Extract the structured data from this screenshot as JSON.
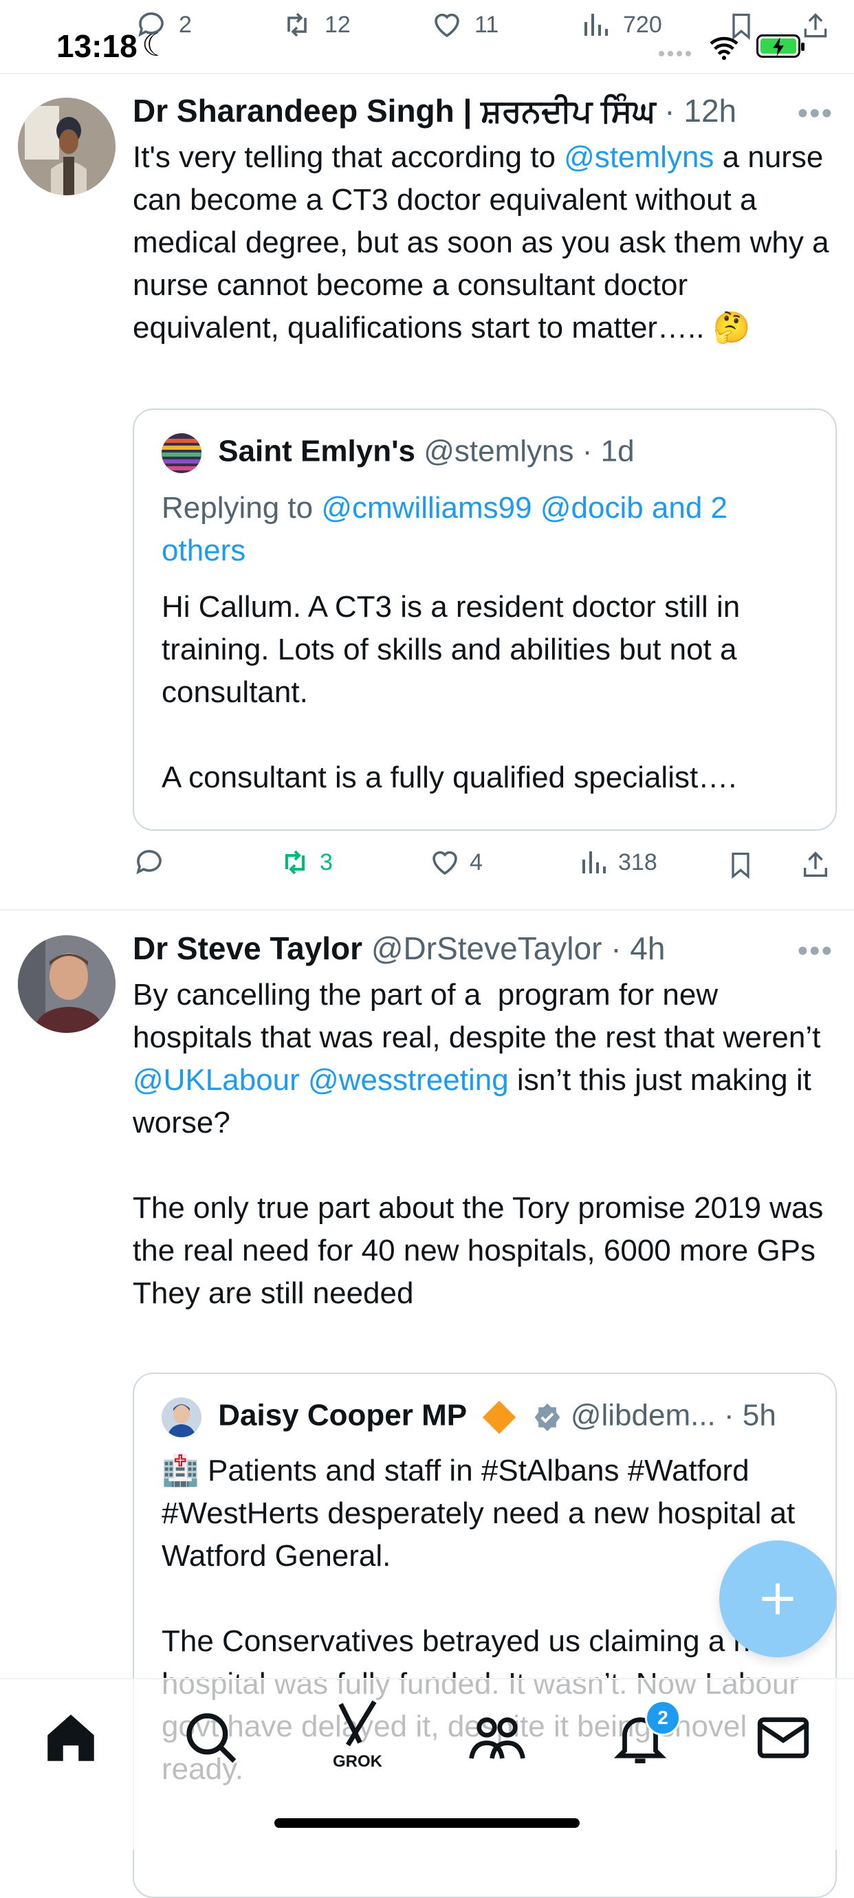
{
  "status_bar": {
    "time": "13:18"
  },
  "top_engagement": {
    "replies": "2",
    "reposts": "12",
    "likes": "11",
    "views": "720"
  },
  "tweets": [
    {
      "author_name": "Dr Sharandeep Singh | ਸ਼ਰਨਦੀਪ ਸਿੰਘ",
      "time": "· 12h",
      "body_part1": "It's very telling that according to ",
      "mention1": "@stemlyns",
      "body_part2": " a nurse can become a CT3 doctor equivalent without a medical degree, but as soon as you ask them why a nurse cannot become a consultant doctor equivalent, qualifications start to matter….. 🤔",
      "quote": {
        "author_name": "Saint Emlyn's",
        "handle_time": "@stemlyns · 1d",
        "replying_prefix": "Replying to ",
        "replying_to": "@cmwilliams99 @docib and 2 others",
        "text": "Hi Callum. A CT3 is a resident doctor still in training. Lots of skills and abilities but not a consultant.\n\nA consultant is a fully qualified specialist…."
      },
      "actions": {
        "replies": "",
        "reposts": "3",
        "likes": "4",
        "views": "318"
      },
      "repost_color": "#00ba7c"
    },
    {
      "author_name": "Dr Steve Taylor",
      "handle_time": "@DrSteveTaylor · 4h",
      "body_part1": "By cancelling the part of a  program for new hospitals that was real, despite the rest that weren’t ",
      "mention1": "@UKLabour",
      "mention_sep": " ",
      "mention2": "@wesstreeting",
      "body_part2": " isn’t this just making it worse?\n\nThe only true part about the Tory promise 2019 was the real need for 40 new hospitals, 6000 more GPs\nThey are still needed",
      "quote": {
        "author_name": "Daisy Cooper MP",
        "handle_time": "@libdem... · 5h",
        "text": "🏥 Patients and staff in #StAlbans #Watford #WestHerts desperately need a new hospital at Watford General.\n\nThe Conservatives betrayed us claiming a new hospital was fully funded. It wasn’t. Now Labour govt have delayed it, despite it being shovel ready."
      }
    }
  ],
  "bottom_nav": {
    "items": [
      "home-icon",
      "search-icon",
      "grok-icon",
      "communities-icon",
      "notifications-icon",
      "messages-icon"
    ],
    "grok_label": "GROK",
    "notifications_badge": "2"
  },
  "colors": {
    "accent": "#1d9bf0",
    "muted": "#536471",
    "repost_active": "#00ba7c",
    "fab": "#8ecdf7"
  }
}
